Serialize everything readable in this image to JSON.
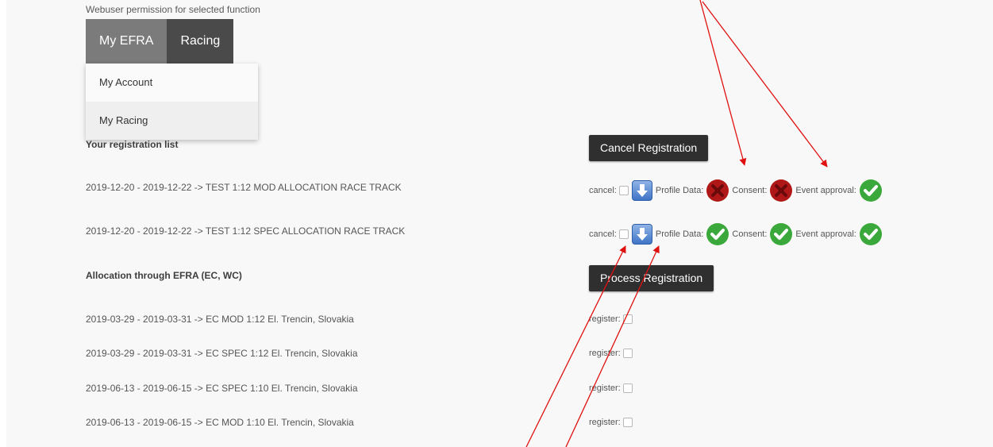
{
  "header": {
    "permission_text": "Webuser permission for selected function"
  },
  "nav": {
    "tabs": [
      {
        "label": "My EFRA"
      },
      {
        "label": "Racing"
      }
    ],
    "dropdown": [
      {
        "label": "My Account"
      },
      {
        "label": "My Racing"
      }
    ]
  },
  "registrations": {
    "title": "Your registration list",
    "cancel_button": "Cancel Registration",
    "labels": {
      "cancel": "cancel:",
      "profile": "Profile Data:",
      "consent": "Consent:",
      "event": "Event approval:"
    },
    "rows": [
      {
        "text": "2019-12-20 - 2019-12-22 -> TEST 1:12 MOD ALLOCATION RACE TRACK",
        "profile_status": "error",
        "consent_status": "error",
        "event_status": "ok"
      },
      {
        "text": "2019-12-20 - 2019-12-22 -> TEST 1:12 SPEC ALLOCATION RACE TRACK",
        "profile_status": "ok",
        "consent_status": "ok",
        "event_status": "ok"
      }
    ]
  },
  "allocation": {
    "title": "Allocation through EFRA (EC, WC)",
    "process_button": "Process Registration",
    "register_label": "register:",
    "rows": [
      {
        "text": "2019-03-29 - 2019-03-31 -> EC MOD 1:12 El. Trencin, Slovakia"
      },
      {
        "text": "2019-03-29 - 2019-03-31 -> EC SPEC 1:12 El. Trencin, Slovakia"
      },
      {
        "text": "2019-06-13 - 2019-06-15 -> EC SPEC 1:10 El. Trencin, Slovakia"
      },
      {
        "text": "2019-06-13 - 2019-06-15 -> EC MOD 1:10 El. Trencin, Slovakia"
      }
    ]
  },
  "colors": {
    "arrow": "#e01010",
    "ok_green": "#3aa83a",
    "error_red": "#b01818",
    "button_dark": "#2f2f2f"
  }
}
